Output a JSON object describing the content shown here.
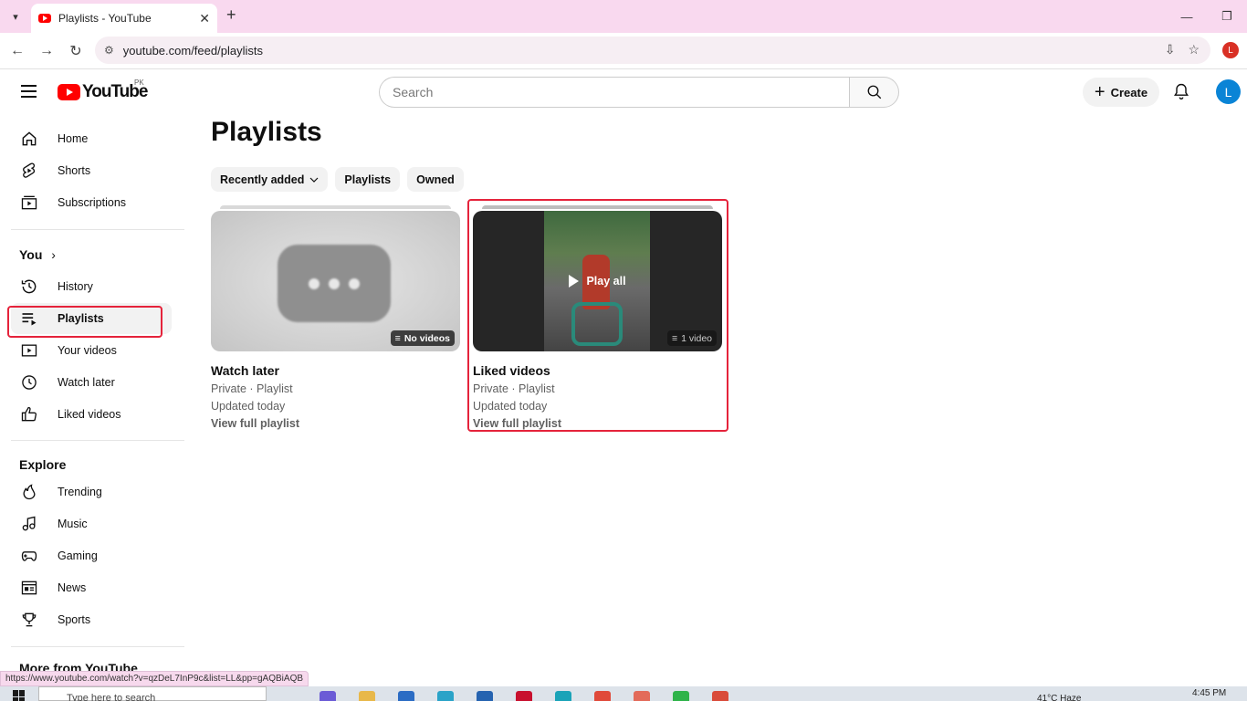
{
  "browser": {
    "tab_title": "Playlists - YouTube",
    "url": "youtube.com/feed/playlists",
    "profile_initial": "L"
  },
  "header": {
    "logo_text": "YouTube",
    "country_code": "PK",
    "search_placeholder": "Search",
    "create_label": "Create",
    "avatar_initial": "L"
  },
  "sidebar": {
    "main_items": [
      {
        "label": "Home",
        "icon": "home-icon"
      },
      {
        "label": "Shorts",
        "icon": "shorts-icon"
      },
      {
        "label": "Subscriptions",
        "icon": "subscriptions-icon"
      }
    ],
    "you_heading": "You",
    "you_items": [
      {
        "label": "History",
        "icon": "history-icon"
      },
      {
        "label": "Playlists",
        "icon": "playlists-icon",
        "active": true
      },
      {
        "label": "Your videos",
        "icon": "your-videos-icon"
      },
      {
        "label": "Watch later",
        "icon": "watch-later-icon"
      },
      {
        "label": "Liked videos",
        "icon": "liked-videos-icon"
      }
    ],
    "explore_heading": "Explore",
    "explore_items": [
      {
        "label": "Trending",
        "icon": "trending-icon"
      },
      {
        "label": "Music",
        "icon": "music-icon"
      },
      {
        "label": "Gaming",
        "icon": "gaming-icon"
      },
      {
        "label": "News",
        "icon": "news-icon"
      },
      {
        "label": "Sports",
        "icon": "sports-icon"
      }
    ],
    "more_heading": "More from YouTube"
  },
  "main": {
    "title": "Playlists",
    "chips": [
      {
        "label": "Recently added",
        "dropdown": true
      },
      {
        "label": "Playlists"
      },
      {
        "label": "Owned"
      }
    ],
    "playlists": [
      {
        "title": "Watch later",
        "privacy": "Private · Playlist",
        "updated": "Updated today",
        "link": "View full playlist",
        "badge": "No videos"
      },
      {
        "title": "Liked videos",
        "privacy": "Private · Playlist",
        "updated": "Updated today",
        "link": "View full playlist",
        "badge": "1 video",
        "hover_label": "Play all"
      }
    ]
  },
  "status_url": "https://www.youtube.com/watch?v=qzDeL7InP9c&list=LL&pp=gAQBiAQB",
  "taskbar": {
    "search_placeholder": "Type here to search",
    "weather": "41°C  Haze",
    "time": "4:45 PM"
  },
  "colors": {
    "youtube_red": "#ff0000",
    "highlight_red": "#e5233b",
    "tab_strip": "#f9d9ef",
    "avatar_blue": "#0a84d6"
  }
}
